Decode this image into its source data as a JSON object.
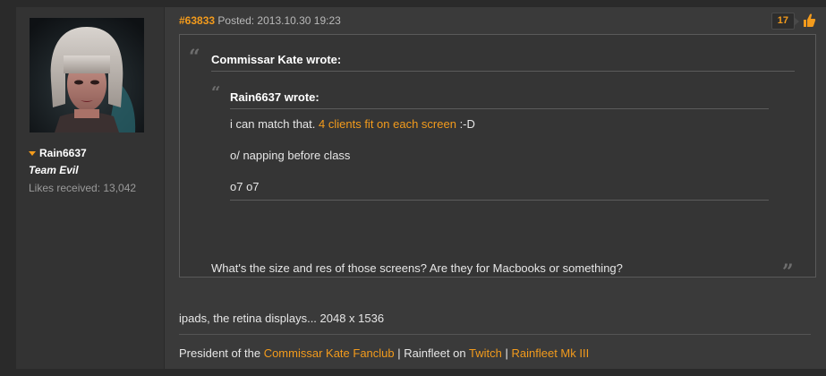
{
  "user": {
    "name": "Rain6637",
    "title": "Team Evil",
    "likes": "Likes received: 13,042"
  },
  "post": {
    "number": "#63833",
    "posted": "Posted: 2013.10.30 19:23",
    "like_count": "17"
  },
  "quote_outer": {
    "author": "Commissar Kate wrote:",
    "inner": {
      "author": "Rain6637 wrote:",
      "line1_text": "i can match that.",
      "line1_link": "4 clients fit on each screen",
      "line1_suffix": ":-D",
      "line2": "o/ napping before class",
      "line3": "o7 o7"
    },
    "text": "What's the size and res of those screens? Are they for Macbooks or something?"
  },
  "reply": "ipads, the retina displays... 2048 x 1536",
  "signature": {
    "prefix": "President of the",
    "link1": "Commissar Kate Fanclub",
    "mid1": "| Rainfleet on",
    "link2": "Twitch",
    "mid2": "|",
    "link3": "Rainfleet Mk III"
  },
  "colors": {
    "accent": "#f39b1c",
    "background": "#2a2a2a",
    "panel": "#3a3a3a"
  },
  "icons": {
    "like": "thumbs-up-icon",
    "caret": "caret-down-icon"
  }
}
